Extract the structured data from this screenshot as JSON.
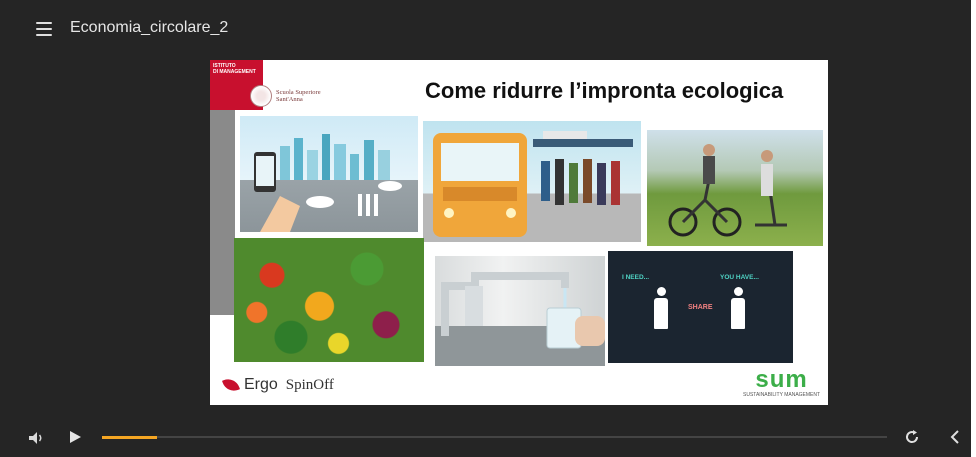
{
  "header": {
    "title": "Economia_circolare_2"
  },
  "slide": {
    "title": "Come ridurre l’impronta ecologica",
    "institute_logo": "ISTITUTO\nDI MANAGEMENT",
    "school_name_1": "Scuola Superiore",
    "school_name_2": "Sant'Anna",
    "share_panel": {
      "need": "I NEED...",
      "have": "YOU HAVE...",
      "share": "SHARE"
    },
    "footer": {
      "ergo": "Ergo",
      "spinoff": "SpinOff",
      "sum": "sum",
      "sum_sub": "SUSTAINABILITY MANAGEMENT"
    }
  },
  "controls": {
    "progress": 0.07,
    "icons": [
      "volume-icon",
      "play-icon",
      "replay-icon",
      "back-icon"
    ]
  },
  "colors": {
    "player_bg": "#252525",
    "accent": "#f5a623",
    "brand_red": "#c8102e",
    "sum_green": "#3cae49"
  }
}
